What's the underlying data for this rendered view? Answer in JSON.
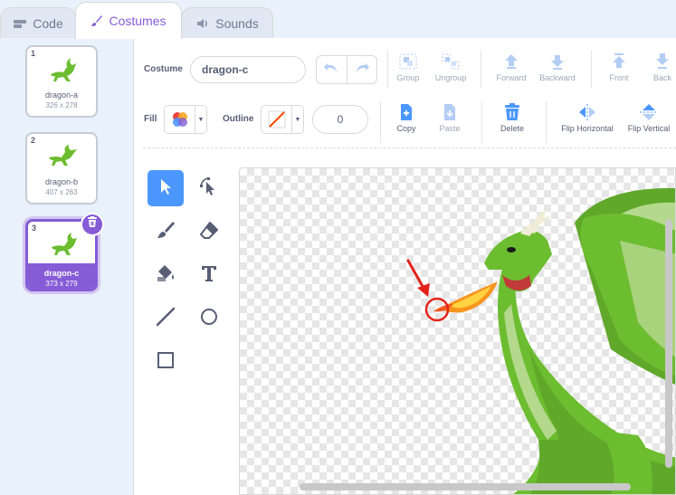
{
  "tabs": [
    {
      "label": "Code",
      "icon": "code-icon"
    },
    {
      "label": "Costumes",
      "icon": "brush-icon"
    },
    {
      "label": "Sounds",
      "icon": "speaker-icon"
    }
  ],
  "costumes": [
    {
      "index": "1",
      "name": "dragon-a",
      "size": "326 x 278"
    },
    {
      "index": "2",
      "name": "dragon-b",
      "size": "407 x 263"
    },
    {
      "index": "3",
      "name": "dragon-c",
      "size": "373 x 279",
      "selected": true
    }
  ],
  "editor": {
    "costume_label": "Costume",
    "costume_name": "dragon-c",
    "fill_label": "Fill",
    "outline_label": "Outline",
    "outline_width": "0",
    "toolbar": {
      "group": "Group",
      "ungroup": "Ungroup",
      "forward": "Forward",
      "backward": "Backward",
      "front": "Front",
      "back": "Back",
      "copy": "Copy",
      "paste": "Paste",
      "delete": "Delete",
      "flip_horizontal": "Flip Horizontal",
      "flip_vertical": "Flip Vertical"
    }
  },
  "colors": {
    "accent": "#855cd6",
    "tool_active": "#4c97ff",
    "dragon_green": "#6cbd30",
    "annotation_red": "#e3231b"
  }
}
